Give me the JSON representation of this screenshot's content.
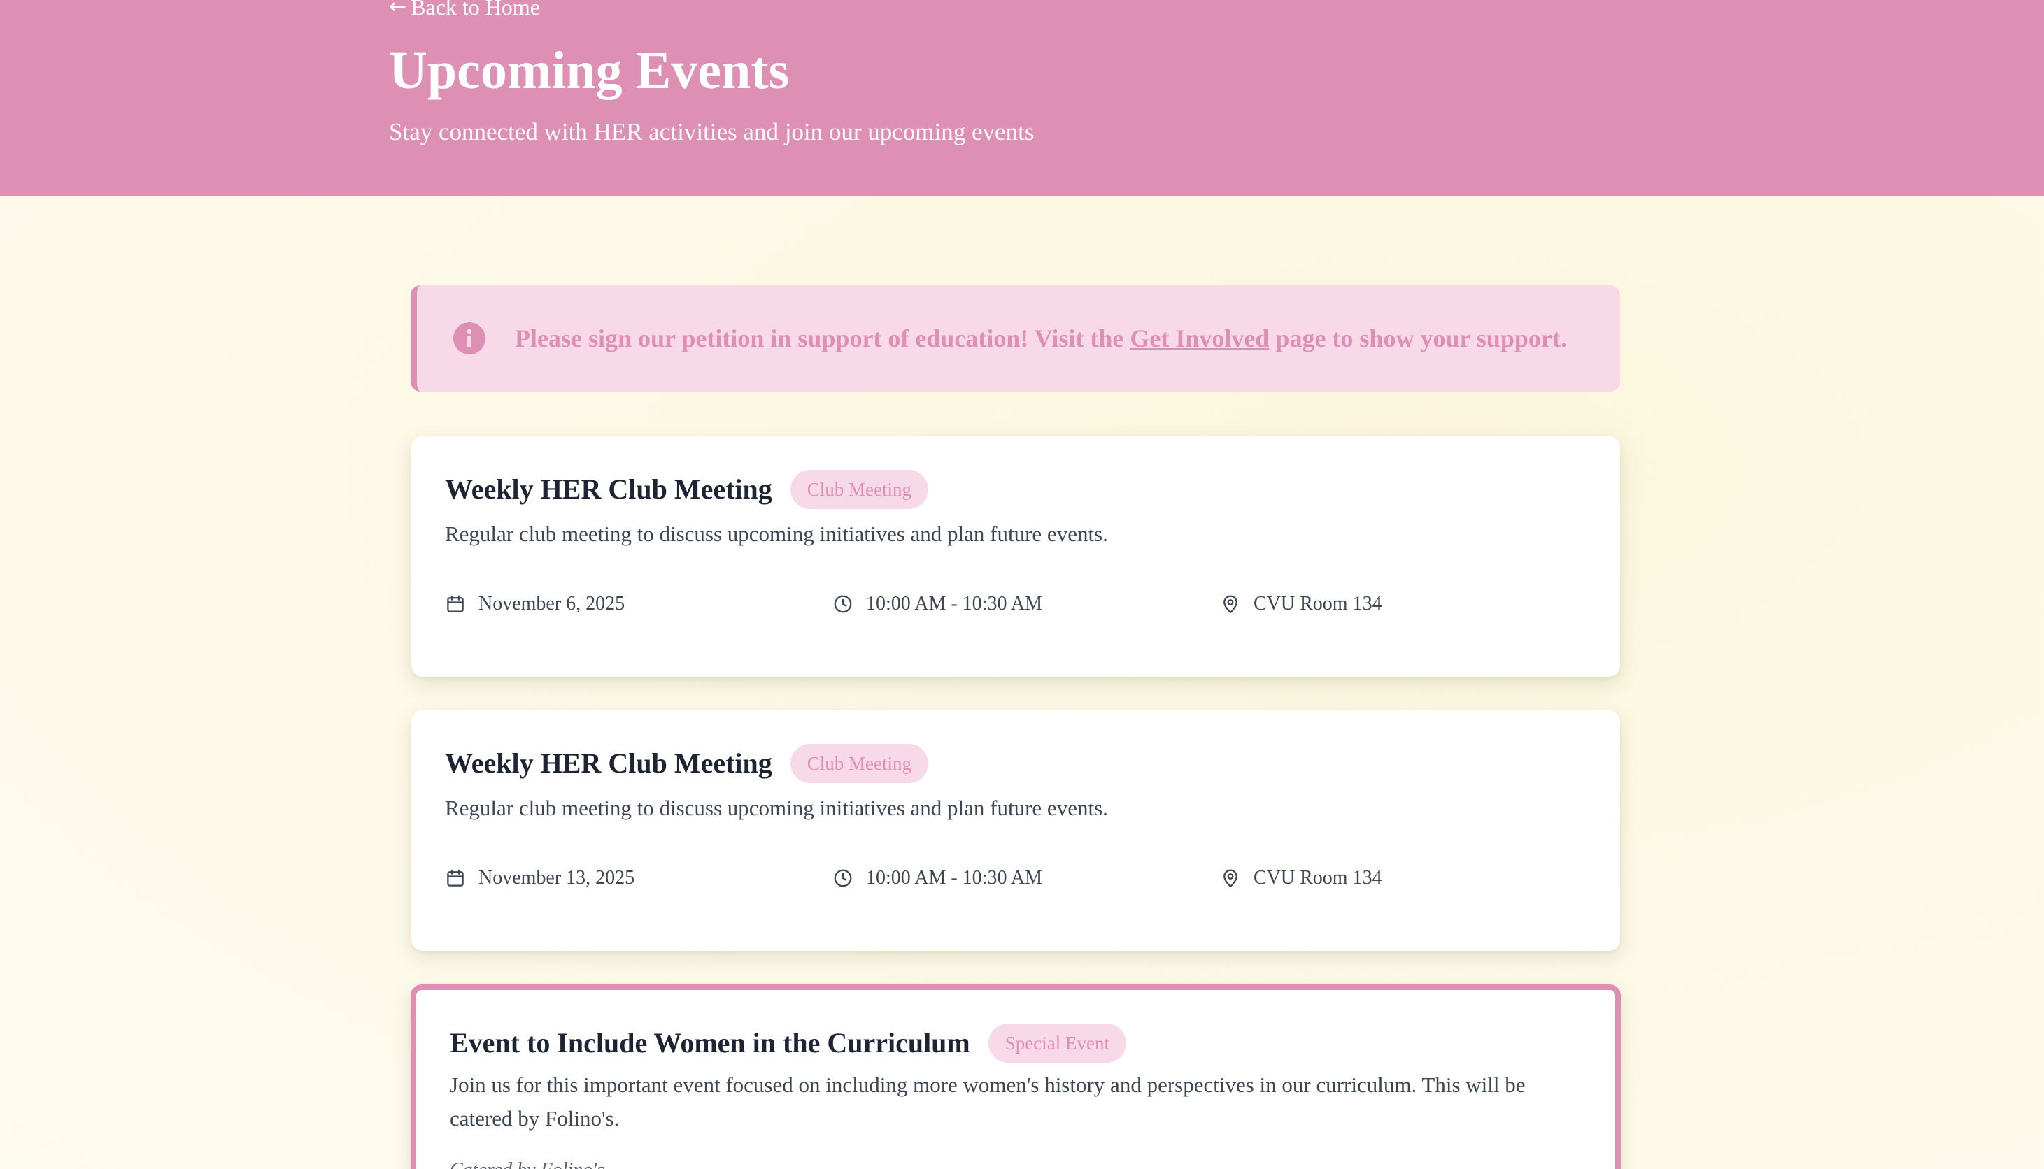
{
  "header": {
    "back_label": "Back to Home",
    "title": "Upcoming Events",
    "subtitle": "Stay connected with HER activities and join our upcoming events",
    "background": "#de8fb4"
  },
  "notice": {
    "text_before": "Please sign our petition in support of education! Visit the ",
    "link_label": "Get Involved",
    "text_after": " page to show your support.",
    "icon": "info-icon"
  },
  "events": [
    {
      "title": "Weekly HER Club Meeting",
      "category": "Club Meeting",
      "description": "Regular club meeting to discuss upcoming initiatives and plan future events.",
      "date": "November 6, 2025",
      "time": "10:00 AM - 10:30 AM",
      "location": "CVU Room 134"
    },
    {
      "title": "Weekly HER Club Meeting",
      "category": "Club Meeting",
      "description": "Regular club meeting to discuss upcoming initiatives and plan future events.",
      "date": "November 13, 2025",
      "time": "10:00 AM - 10:30 AM",
      "location": "CVU Room 134"
    },
    {
      "title": "Event to Include Women in the Curriculum",
      "category": "Special Event",
      "description": "Join us for this important event focused on including more women's history and perspectives in our curriculum. This will be catered by Folino's.",
      "caterer_note": "Catered by Folino's"
    }
  ],
  "colors": {
    "accent": "#de8fb4",
    "badge_bg": "#f8d9e7",
    "title_text": "#1e2433",
    "body_text": "#3d4654",
    "page_bg": "#fdf9e6"
  }
}
